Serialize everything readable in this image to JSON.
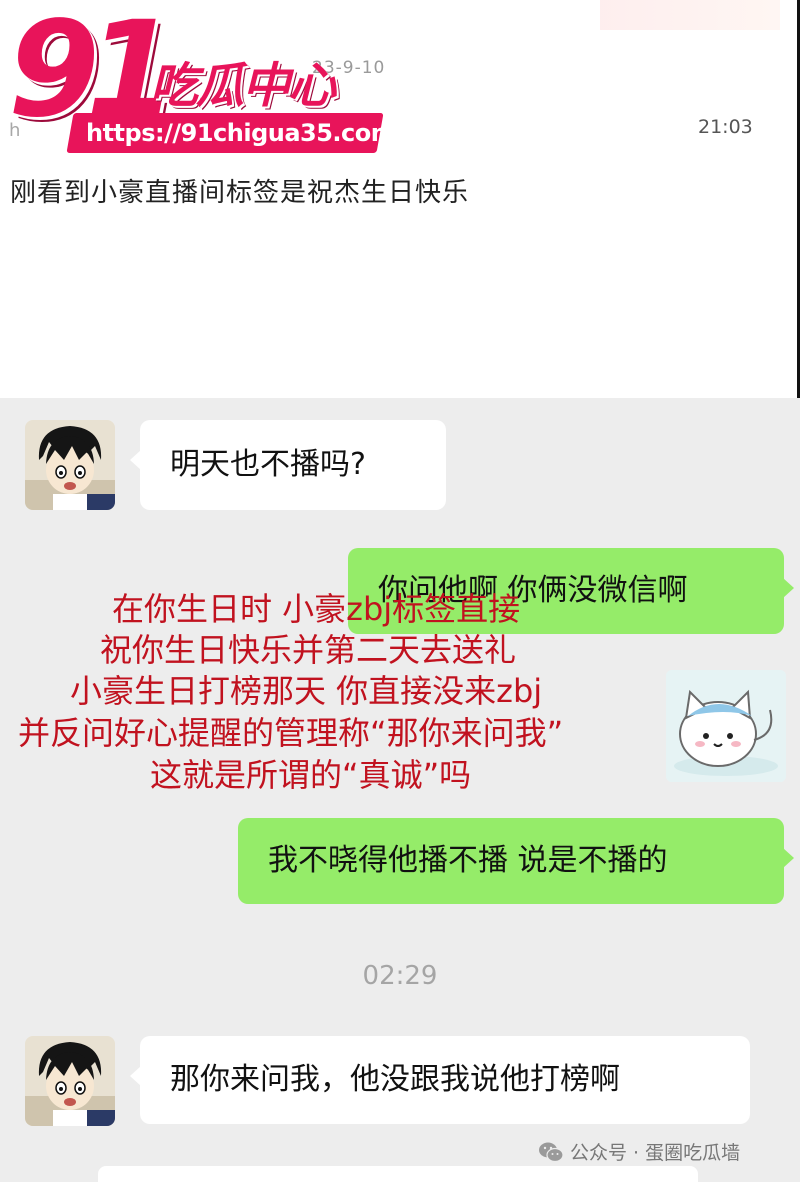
{
  "logo": {
    "number": "91",
    "title": "吃瓜中心",
    "url": "https://91chigua35.com"
  },
  "post": {
    "date": "23-9-10",
    "initial": "h",
    "time": "21:03",
    "text": "刚看到小豪直播间标签是祝杰生日快乐"
  },
  "chat": {
    "messages": [
      {
        "side": "in",
        "text": "明天也不播吗?"
      },
      {
        "side": "out",
        "text": "你问他啊 你俩没微信啊"
      },
      {
        "side": "out",
        "text": "我不晓得他播不播 说是不播的"
      },
      {
        "side": "in",
        "text": "那你来问我，他没跟我说他打榜啊"
      }
    ],
    "timestamp": "02:29",
    "sticker": "cat-sticker"
  },
  "annotation": {
    "lines": [
      "在你生日时 小豪zbj标签直接",
      "祝你生日快乐并第二天去送礼",
      "小豪生日打榜那天 你直接没来zbj",
      "并反问好心提醒的管理称“那你来问我”",
      "这就是所谓的“真诚”吗"
    ],
    "color": "#c1121f"
  },
  "footer": {
    "source_label": "公众号 · 蛋圈吃瓜墙"
  },
  "colors": {
    "brand_pink": "#e8145a",
    "bubble_green": "#95ec69",
    "chat_bg": "#ededed"
  }
}
